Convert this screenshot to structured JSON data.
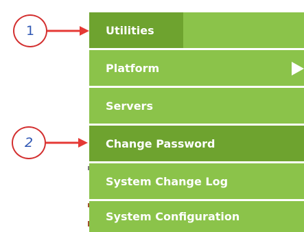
{
  "menu": {
    "tab_label": "Utilities",
    "items": [
      {
        "label": "Platform",
        "has_submenu": true
      },
      {
        "label": "Servers",
        "has_submenu": false
      },
      {
        "label": "Change Password",
        "has_submenu": false,
        "selected": true
      },
      {
        "label": "System Change Log",
        "has_submenu": false
      },
      {
        "label": "System Configuration",
        "has_submenu": false
      }
    ]
  },
  "callouts": [
    "1",
    "2"
  ],
  "colors": {
    "menu_bg": "#8bc34a",
    "menu_selected_bg": "#6ea32f",
    "menu_text": "#ffffff",
    "callout_border": "#d32f2f",
    "callout_number": "#2e56b3",
    "arrow": "#e53935"
  }
}
